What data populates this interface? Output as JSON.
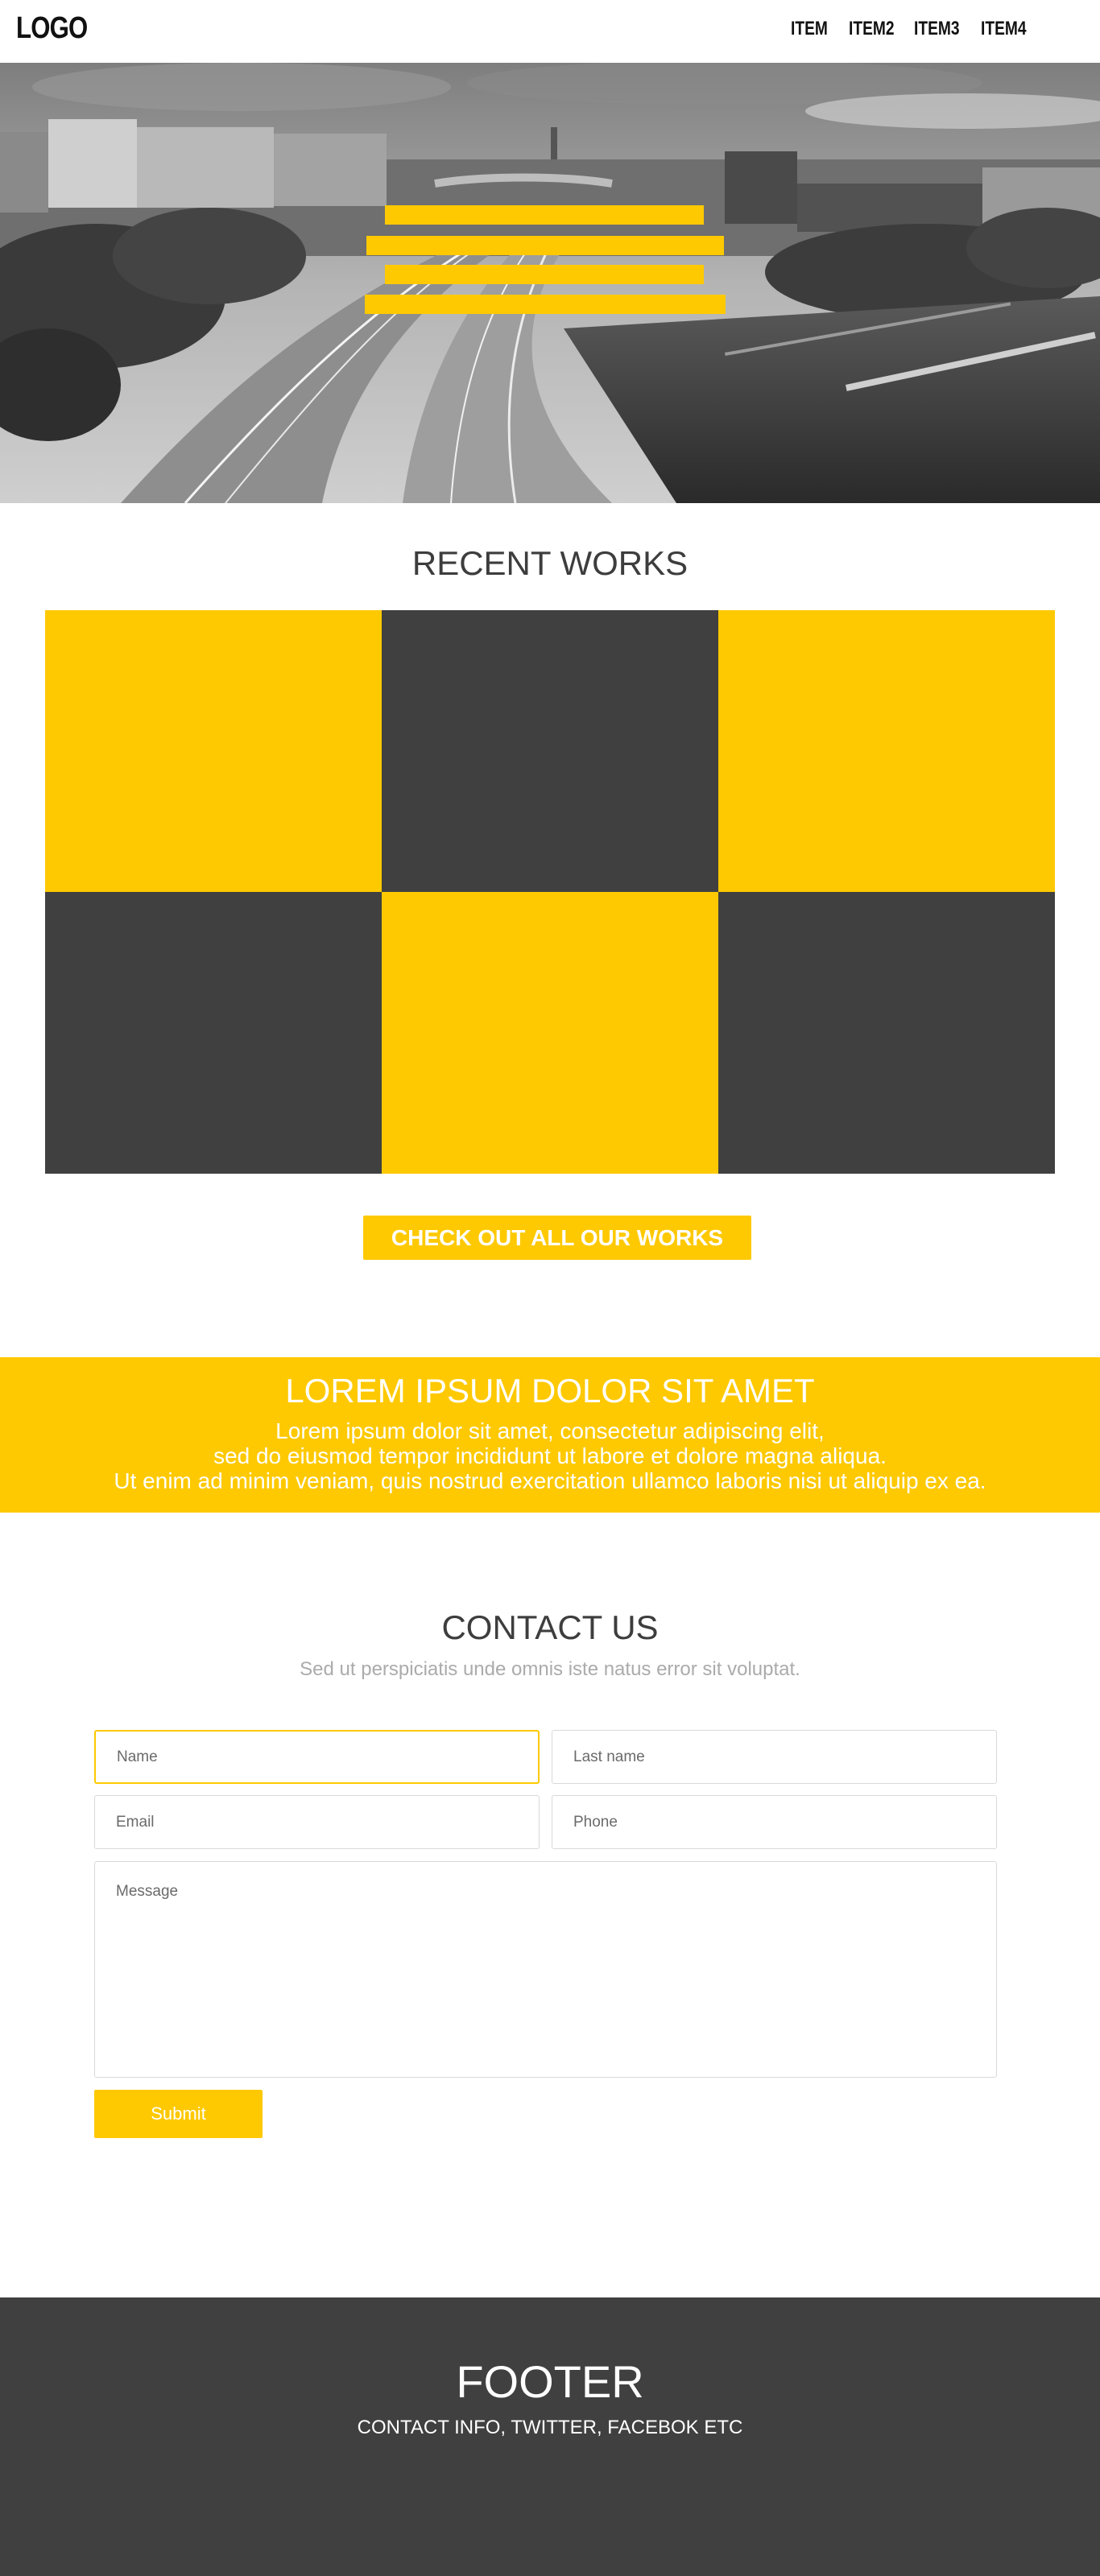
{
  "header": {
    "logo": "LOGO",
    "nav": [
      "ITEM",
      "ITEM2",
      "ITEM3",
      "ITEM4"
    ]
  },
  "hero": {
    "image": "grayscale city highway photo",
    "bar_color": "#fec901"
  },
  "works": {
    "title": "RECENT WORKS",
    "tiles": [
      "yellow",
      "dark",
      "yellow",
      "dark",
      "yellow",
      "dark"
    ],
    "cta_label": "CHECK OUT ALL OUR WORKS"
  },
  "banner": {
    "title": "LOREM IPSUM DOLOR SIT AMET",
    "lines": [
      "Lorem ipsum dolor sit amet, consectetur adipiscing elit,",
      "sed do eiusmod tempor incididunt ut labore et dolore magna aliqua.",
      "Ut enim ad minim veniam, quis nostrud exercitation ullamco laboris nisi ut aliquip ex ea."
    ]
  },
  "contact": {
    "title": "CONTACT US",
    "subtitle": "Sed ut perspiciatis unde omnis iste natus error sit voluptat.",
    "fields": {
      "name_placeholder": "Name",
      "last_name_placeholder": "Last name",
      "email_placeholder": "Email",
      "phone_placeholder": "Phone",
      "message_placeholder": "Message"
    },
    "submit_label": "Submit"
  },
  "footer": {
    "title": "FOOTER",
    "info": "CONTACT INFO, TWITTER, FACEBOK ETC"
  },
  "colors": {
    "accent": "#fec901",
    "dark": "#404040",
    "text": "#3d3d3d",
    "muted": "#ababab"
  }
}
